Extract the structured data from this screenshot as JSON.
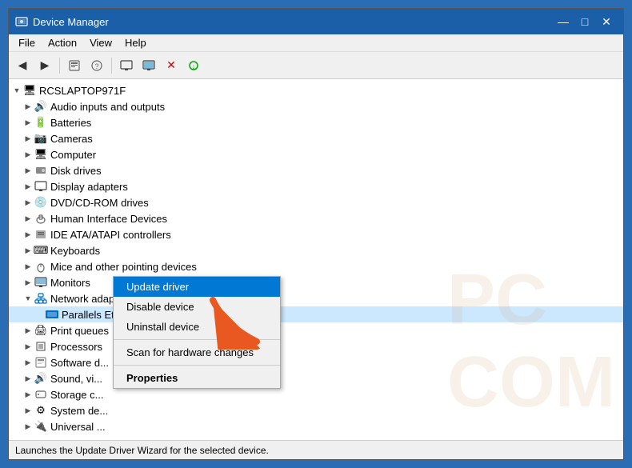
{
  "window": {
    "title": "Device Manager",
    "icon": "⚙",
    "min_btn": "—",
    "max_btn": "□",
    "close_btn": "✕"
  },
  "menu": {
    "items": [
      "File",
      "Action",
      "View",
      "Help"
    ]
  },
  "toolbar": {
    "buttons": [
      "◀",
      "▶",
      "🖥",
      "📄",
      "❓",
      "📋",
      "🖥",
      "⚡",
      "✕",
      "⬇"
    ]
  },
  "tree": {
    "root": "RCSLAPTOP971F",
    "items": [
      {
        "label": "Audio inputs and outputs",
        "indent": 1,
        "expand": "▶",
        "icon": "🔊"
      },
      {
        "label": "Batteries",
        "indent": 1,
        "expand": "▶",
        "icon": "🔋"
      },
      {
        "label": "Cameras",
        "indent": 1,
        "expand": "▶",
        "icon": "📷"
      },
      {
        "label": "Computer",
        "indent": 1,
        "expand": "▶",
        "icon": "🖥"
      },
      {
        "label": "Disk drives",
        "indent": 1,
        "expand": "▶",
        "icon": "💿"
      },
      {
        "label": "Display adapters",
        "indent": 1,
        "expand": "▶",
        "icon": "🖵"
      },
      {
        "label": "DVD/CD-ROM drives",
        "indent": 1,
        "expand": "▶",
        "icon": "💿"
      },
      {
        "label": "Human Interface Devices",
        "indent": 1,
        "expand": "▶",
        "icon": "🕹"
      },
      {
        "label": "IDE ATA/ATAPI controllers",
        "indent": 1,
        "expand": "▶",
        "icon": "📦"
      },
      {
        "label": "Keyboards",
        "indent": 1,
        "expand": "▶",
        "icon": "⌨"
      },
      {
        "label": "Mice and other pointing devices",
        "indent": 1,
        "expand": "▶",
        "icon": "🖱"
      },
      {
        "label": "Monitors",
        "indent": 1,
        "expand": "▶",
        "icon": "🖥"
      },
      {
        "label": "Network adapters",
        "indent": 1,
        "expand": "▼",
        "icon": "🌐"
      },
      {
        "label": "Parallels Ethernet Adapter",
        "indent": 2,
        "expand": "",
        "icon": "🌐",
        "selected": true
      },
      {
        "label": "Print queues",
        "indent": 1,
        "expand": "▶",
        "icon": "🖨"
      },
      {
        "label": "Processors",
        "indent": 1,
        "expand": "▶",
        "icon": "⚙"
      },
      {
        "label": "Software d...",
        "indent": 1,
        "expand": "▶",
        "icon": "💾"
      },
      {
        "label": "Sound, vi...",
        "indent": 1,
        "expand": "▶",
        "icon": "🔊"
      },
      {
        "label": "Storage c...",
        "indent": 1,
        "expand": "▶",
        "icon": "💾"
      },
      {
        "label": "System de...",
        "indent": 1,
        "expand": "▶",
        "icon": "⚙"
      },
      {
        "label": "Universal ...",
        "indent": 1,
        "expand": "▶",
        "icon": "🔌"
      }
    ]
  },
  "context_menu": {
    "items": [
      {
        "label": "Update driver",
        "type": "normal",
        "highlighted": true
      },
      {
        "label": "Disable device",
        "type": "normal"
      },
      {
        "label": "Uninstall device",
        "type": "normal"
      },
      {
        "separator": true
      },
      {
        "label": "Scan for hardware changes",
        "type": "normal"
      },
      {
        "separator": true
      },
      {
        "label": "Properties",
        "type": "bold"
      }
    ]
  },
  "status_bar": {
    "text": "Launches the Update Driver Wizard for the selected device."
  }
}
